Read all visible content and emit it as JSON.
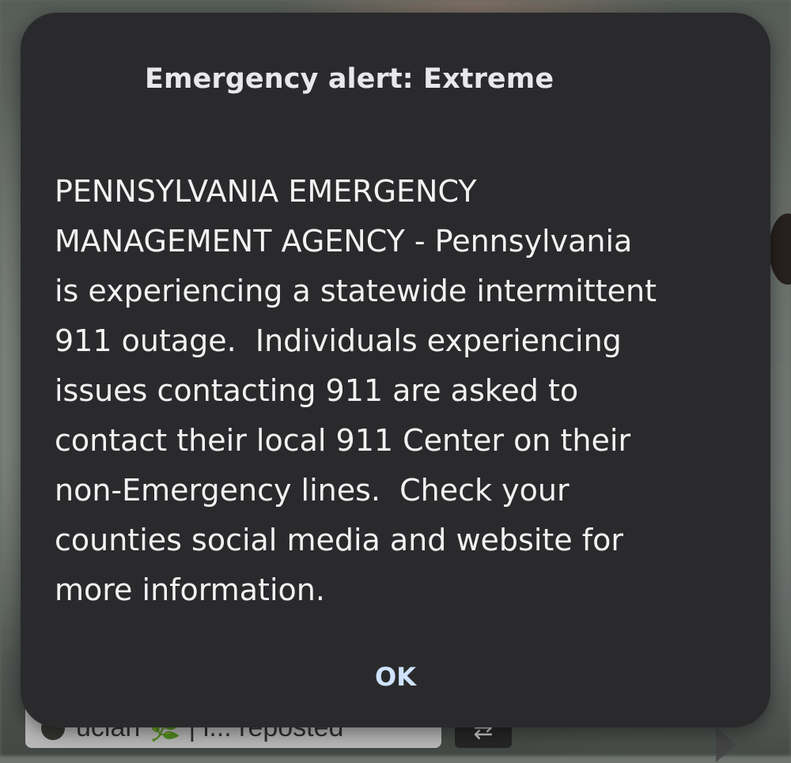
{
  "dialog": {
    "title": "Emergency alert: Extreme",
    "body": "PENNSYLVANIA EMERGENCY\nMANAGEMENT AGENCY - Pennsylvania\nis experiencing a statewide intermittent\n911 outage.  Individuals experiencing\nissues contacting 911 are asked to\ncontact their local 911 Center on their\nnon-Emergency lines.  Check your\ncounties social media and website for\nmore information.",
    "ok_label": "OK"
  },
  "background": {
    "repost_text": "ucian  🌿 | i... reposted",
    "action_icon": "repost-icon",
    "arrow_icon": "share-arrow-icon"
  },
  "colors": {
    "dialog_background": "#2a2a2c",
    "title_text": "#e8e8ea",
    "body_text": "#f2f2f3",
    "button_text": "#cfe3ff"
  }
}
